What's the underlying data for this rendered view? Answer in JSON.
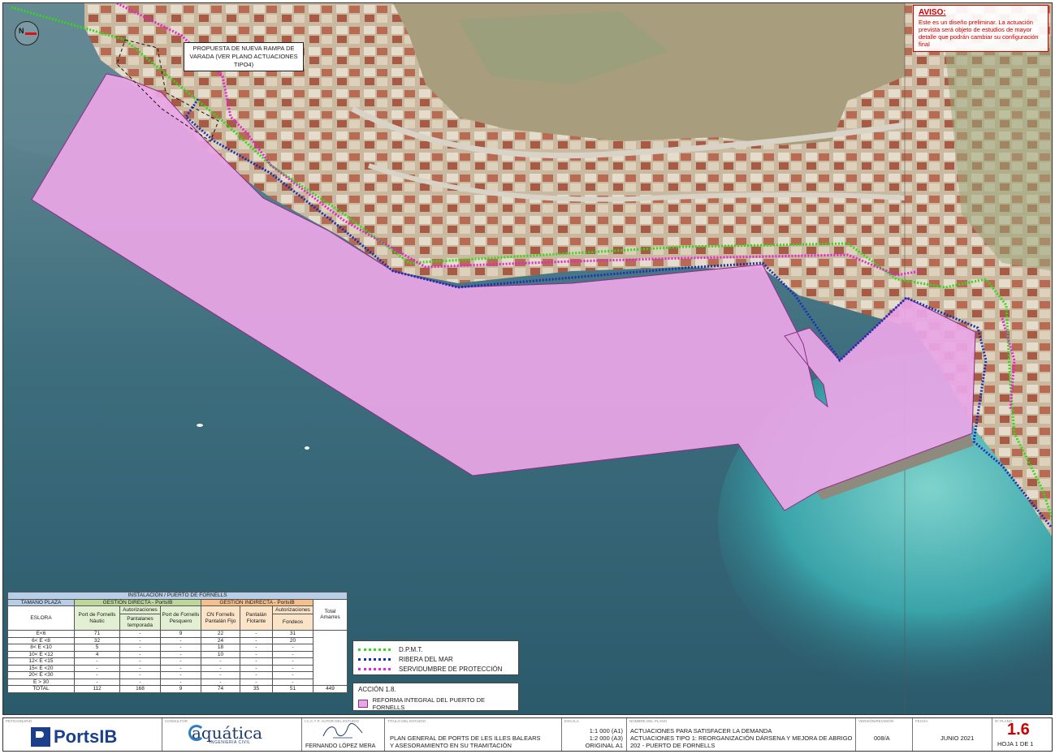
{
  "map": {
    "callout_text": "PROPUESTA DE NUEVA RAMPA DE VARADA (VER PLANO ACTUACIONES TIPO4)",
    "north_label": "N",
    "colors": {
      "sea_deep": "#2f6478",
      "sea_shallow": "#58b9b7",
      "land": "#c2b59a",
      "reform_fill": "#eaa6e6",
      "reform_stroke": "#8a2d86",
      "dpmt": "#33d81a",
      "ribera": "#1a2fb6",
      "servidumbre": "#e523d6"
    }
  },
  "aviso": {
    "title": "AVISO:",
    "text": "Este es un diseño preliminar. La actuación prevista será objeto de estudios de mayor detalle que podrán cambiar su configuración final"
  },
  "table": {
    "title": "INSTALACIÓN / PUERTO DE FORNELLS",
    "col_size": "TAMAÑO PLAZA",
    "group_direct": "GESTIÓN DIRECTA - PortsIB",
    "group_indirect": "GESTIÓN INDIRECTA - PortsIB",
    "eslora": "ESLORA",
    "h_nautico": "Port de Fornells Nàutic",
    "h_autoriz1": "Autorizaciones",
    "h_pant_temp": "Pantalanes temporada",
    "h_pesquero": "Port de Fornells Pesquero",
    "h_cn": "CN Fornells Pantalán Fijo",
    "h_flotante": "Pantalán Flotante",
    "h_autoriz2": "Autorizaciones",
    "h_fondeos": "Fondeos",
    "h_total": "Total Amarres",
    "rows": [
      {
        "size": "E<6",
        "nautico": "71",
        "temporada": "-",
        "pesquero": "9",
        "cn": "22",
        "flotante": "-",
        "fondeos": "31"
      },
      {
        "size": "6< E <8",
        "nautico": "32",
        "temporada": "-",
        "pesquero": "-",
        "cn": "24",
        "flotante": "-",
        "fondeos": "20"
      },
      {
        "size": "8< E <10",
        "nautico": "5",
        "temporada": "-",
        "pesquero": "-",
        "cn": "18",
        "flotante": "-",
        "fondeos": "-"
      },
      {
        "size": "10< E <12",
        "nautico": "4",
        "temporada": "-",
        "pesquero": "-",
        "cn": "10",
        "flotante": "-",
        "fondeos": "-"
      },
      {
        "size": "12< E <15",
        "nautico": "-",
        "temporada": "-",
        "pesquero": "-",
        "cn": "-",
        "flotante": "-",
        "fondeos": "-"
      },
      {
        "size": "15< E <20",
        "nautico": "-",
        "temporada": "-",
        "pesquero": "-",
        "cn": "-",
        "flotante": "-",
        "fondeos": "-"
      },
      {
        "size": "20< E <30",
        "nautico": "-",
        "temporada": "-",
        "pesquero": "-",
        "cn": "-",
        "flotante": "-",
        "fondeos": "-"
      },
      {
        "size": "E > 30",
        "nautico": "-",
        "temporada": "-",
        "pesquero": "-",
        "cn": "-",
        "flotante": "-",
        "fondeos": "-"
      }
    ],
    "total": {
      "size": "TOTAL",
      "nautico": "112",
      "temporada": "168",
      "pesquero": "9",
      "cn": "74",
      "flotante": "35",
      "fondeos": "51",
      "grand": "449"
    }
  },
  "legend": {
    "items": [
      {
        "label": "D.P.M.T.",
        "color": "#33d81a"
      },
      {
        "label": "RIBERA DEL MAR",
        "color": "#1a2fb6"
      },
      {
        "label": "SERVIDUMBRE DE PROTECCIÓN",
        "color": "#e523d6"
      }
    ]
  },
  "action": {
    "title": "ACCIÓN 1.8.",
    "label": "REFORMA INTEGRAL DEL PUERTO DE FORNELLS"
  },
  "title_block": {
    "peticionario_lbl": "PETICIONARIO",
    "ports_logo": "PortsIB",
    "consultor_lbl": "CONSULTOR",
    "aq_logo": "aquática",
    "aq_sub": "INGENIERÍA CIVIL",
    "autor_lbl": "I.C.C.Y P. AUTOR DEL ESTUDIO",
    "autor": "FERNANDO LÓPEZ MERA",
    "estudio_lbl": "TÍTULO DEL ESTUDIO",
    "estudio_1": "PLAN GENERAL DE PORTS DE LES ILLES BALEARS",
    "estudio_2": "Y ASESORAMIENTO EN SU TRAMITACIÓN",
    "escala_lbl": "ESCALA",
    "escala_1": "1:1 000 (A1)",
    "escala_2": "1:2 000 (A3)",
    "escala_3": "ORIGINAL A1",
    "plano_lbl": "NOMBRE DEL PLANO",
    "plano_1": "ACTUACIONES PARA SATISFACER LA DEMANDA",
    "plano_2": "ACTUACIONES TIPO 1: REORGANIZACIÓN DÁRSENA Y MEJORA DE ABRIGO",
    "plano_3": "202 - PUERTO DE FORNELLS",
    "version_lbl": "VERSIÓN/REVISIÓN",
    "version": "008/A",
    "fecha_lbl": "FECHA",
    "fecha": "JUNIO 2021",
    "numero_lbl": "Nº PLANO",
    "numero": "1.6",
    "hoja": "HOJA 1 DE 1"
  }
}
